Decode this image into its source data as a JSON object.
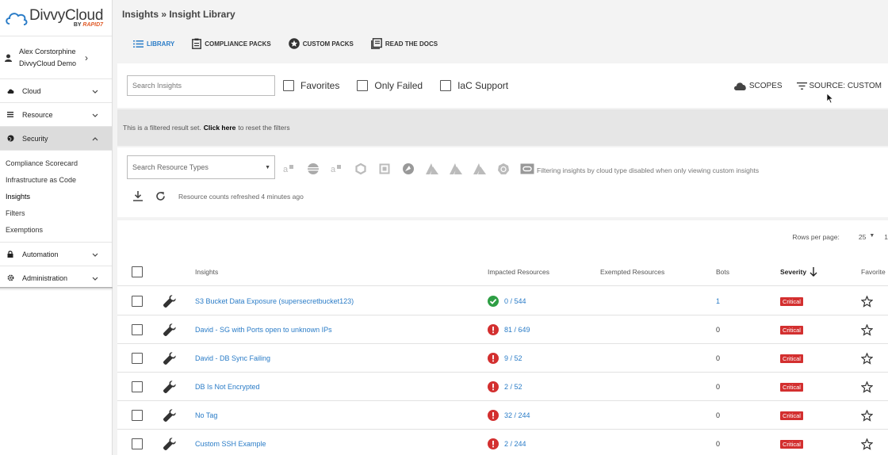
{
  "brand": {
    "name": "DivvyCloud",
    "by": "BY",
    "rapid": "RAPID7"
  },
  "user": {
    "name": "Alex Corstorphine",
    "org": "DivvyCloud Demo"
  },
  "nav": {
    "cloud": "Cloud",
    "resource": "Resource",
    "security": "Security",
    "security_sub": [
      "Compliance Scorecard",
      "Infrastructure as Code",
      "Insights",
      "Filters",
      "Exemptions"
    ],
    "automation": "Automation",
    "administration": "Administration"
  },
  "breadcrumb": "Insights » Insight Library",
  "tabs": {
    "library": "LIBRARY",
    "compliance": "COMPLIANCE PACKS",
    "custom": "CUSTOM PACKS",
    "docs": "READ THE DOCS"
  },
  "filters": {
    "search_placeholder": "Search Insights",
    "favorites": "Favorites",
    "only_failed": "Only Failed",
    "iac_support": "IaC Support",
    "scopes": "SCOPES",
    "source": "SOURCE: CUSTOM"
  },
  "info_bar": {
    "prefix": "This is a filtered result set.",
    "link": "Click here",
    "suffix": "to reset the filters"
  },
  "resources": {
    "search_placeholder": "Search Resource Types",
    "cloud_note": "Filtering insights by cloud type disabled when only viewing custom insights",
    "refresh_text": "Resource counts refreshed 4 minutes ago"
  },
  "table": {
    "rows_per_page_label": "Rows per page:",
    "rows_per_page_value": "25",
    "page": "1",
    "headers": {
      "insights": "Insights",
      "impacted": "Impacted Resources",
      "exempted": "Exempted Resources",
      "bots": "Bots",
      "severity": "Severity",
      "favorite": "Favorite"
    },
    "rows": [
      {
        "name": "S3 Bucket Data Exposure (supersecretbucket123)",
        "impacted": "0 / 544",
        "status": "ok",
        "bots": "1",
        "severity": "Critical"
      },
      {
        "name": "David - SG with Ports open to unknown IPs",
        "impacted": "81 / 649",
        "status": "fail",
        "bots": "0",
        "severity": "Critical"
      },
      {
        "name": "David - DB Sync Failing",
        "impacted": "9 / 52",
        "status": "fail",
        "bots": "0",
        "severity": "Critical"
      },
      {
        "name": "DB Is Not Encrypted",
        "impacted": "2 / 52",
        "status": "fail",
        "bots": "0",
        "severity": "Critical"
      },
      {
        "name": "No Tag",
        "impacted": "32 / 244",
        "status": "fail",
        "bots": "0",
        "severity": "Critical"
      },
      {
        "name": "Custom SSH Example",
        "impacted": "2 / 244",
        "status": "fail",
        "bots": "0",
        "severity": "Critical"
      }
    ]
  },
  "colors": {
    "accent": "#2a7cc7",
    "critical": "#d32f2f",
    "ok": "#2e9e44"
  }
}
